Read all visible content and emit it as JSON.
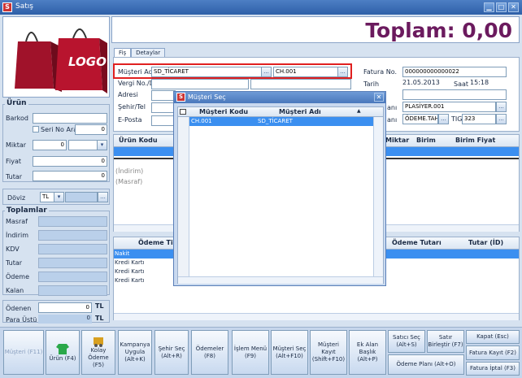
{
  "window": {
    "title": "Satış",
    "app_icon": "S"
  },
  "toplam": {
    "text": "Toplam: 0,00"
  },
  "logo": {
    "text": "LOGO"
  },
  "tabs": [
    {
      "label": "Fiş"
    },
    {
      "label": "Detaylar"
    }
  ],
  "form": {
    "musteri_adi_label": "Müşteri Adı",
    "musteri_adi_value": "SD_TİCARET",
    "musteri_kodu_value": "CH.001",
    "vergi_label": "Vergi No./D.",
    "adresi_label": "Adresi",
    "sehir_label": "Şehir/Tel",
    "eposta_label": "E-Posta",
    "fatura_no_label": "Fatura No.",
    "fatura_no_value": "000000000000022",
    "tarih_label": "Tarih",
    "tarih_value": "21.05.2013",
    "saat_label": "Saat",
    "saat_value": "15:18",
    "ani1": "anı",
    "plasiyer_value": "PLASİYER.001",
    "ani2": "anı",
    "odeme_value": "ÖDEME.TAH.(",
    "tig_label": "TIG",
    "tig_value": "323",
    "ellipsis": "..."
  },
  "urun": {
    "title": "Ürün",
    "barkod_label": "Barkod",
    "seri_no_label": "Seri No Ara",
    "seri_no_value": "0",
    "miktar_label": "Miktar",
    "miktar_value": "0",
    "fiyat_label": "Fiyat",
    "fiyat_value": "0",
    "tutar_label": "Tutar",
    "tutar_value": "0"
  },
  "doviz": {
    "label": "Döviz",
    "value": "TL"
  },
  "toplamlar": {
    "title": "Toplamlar",
    "rows": [
      "Masraf",
      "İndirim",
      "KDV",
      "Tutar",
      "Ödeme",
      "Kalan"
    ]
  },
  "odenen": {
    "label": "Ödenen",
    "value": "0",
    "unit": "TL"
  },
  "para_ustu": {
    "label": "Para Üstü",
    "value": "0",
    "unit": "TL"
  },
  "product_grid": {
    "headers": [
      "Ürün Kodu",
      "Miktar",
      "Birim",
      "Birim Fiyat"
    ],
    "lines": [
      "(İndirim)",
      "(Masraf)"
    ]
  },
  "payment_grid": {
    "headers": [
      "Ödeme Tipi",
      "Ödeme Tutarı",
      "Tutar (İD)"
    ],
    "rows": [
      "Nakit",
      "Kredi Kartı",
      "Kredi Kartı",
      "Kredi Kartı"
    ]
  },
  "dialog": {
    "title": "Müşteri Seç",
    "col_code": "Müşteri Kodu",
    "col_name": "Müşteri Adı",
    "row_code": "CH.001",
    "row_name": "SD_TİCARET"
  },
  "buttons": {
    "musteri": "Müşteri (F11)",
    "urun": "Ürün (F4)",
    "kolay_odeme": "Kolay Ödeme (F5)",
    "kampanya": "Kampanya Uygula (Alt+K)",
    "sehir": "Şehir Seç (Alt+R)",
    "odemeler": "Ödemeler (F8)",
    "islem": "İşlem Menü (F9)",
    "musteri_sec": "Müşteri Seç (Alt+F10)",
    "musteri_kayit": "Müşteri Kayıt (Shift+F10)",
    "ek_alan": "Ek Alan Başlık (Alt+P)",
    "satici": "Satıcı Seç (Alt+S)",
    "satir": "Satır Birleştir (F7)",
    "odeme_plani": "Ödeme Planı (Alt+O)",
    "kapat": "Kapat (Esc)",
    "fatura_kayit": "Fatura Kayıt (F2)",
    "fatura_iptal": "Fatura İptal (F3)"
  }
}
